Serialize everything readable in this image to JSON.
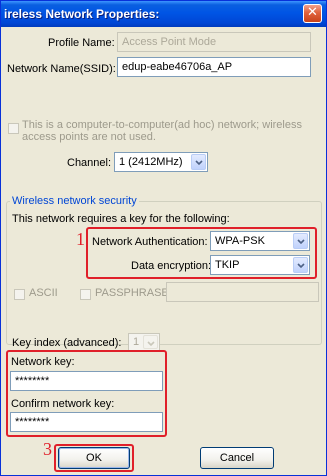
{
  "window": {
    "title": "ireless Network Properties:",
    "close_glyph": "✕"
  },
  "profile": {
    "label": "Profile Name:",
    "value": "Access Point Mode"
  },
  "ssid": {
    "label": "Network Name(SSID):",
    "value": "edup-eabe46706a_AP"
  },
  "adhoc": {
    "line1": "This is a computer-to-computer(ad hoc) network; wireless",
    "line2": "access points are not used."
  },
  "channel": {
    "label": "Channel:",
    "value": "1  (2412MHz)"
  },
  "security": {
    "group_title": "Wireless network security",
    "requires_text": "This network requires a key for the following:",
    "auth_label": "Network Authentication:",
    "auth_value": "WPA-PSK",
    "encryption_label": "Data encryption:",
    "encryption_value": "TKIP",
    "ascii_label": "ASCII",
    "passphrase_label": "PASSPHRASE"
  },
  "key_index": {
    "label": "Key index (advanced):",
    "value": "1"
  },
  "network_key": {
    "label": "Network key:",
    "value": "********"
  },
  "confirm_key": {
    "label": "Confirm network key:",
    "value": "********"
  },
  "markers": {
    "one": "1",
    "three": "3"
  },
  "buttons": {
    "ok": "OK",
    "cancel": "Cancel"
  },
  "colors": {
    "highlight": "#e0202a",
    "title_bar": "#0055e5",
    "group_title": "#0046d5"
  }
}
